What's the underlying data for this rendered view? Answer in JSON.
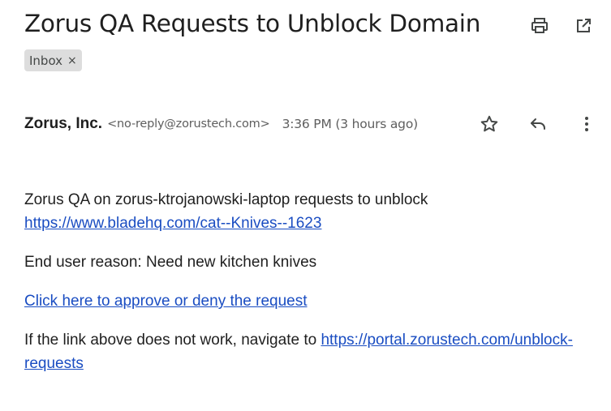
{
  "email": {
    "subject": "Zorus QA Requests to Unblock Domain",
    "label": "Inbox",
    "label_remove": "×",
    "sender_name": "Zorus, Inc.",
    "sender_email": "<no-reply@zorustech.com>",
    "time": "3:36 PM (3 hours ago)"
  },
  "toolbar": {
    "icons": [
      "print-icon",
      "open-in-new-window-icon",
      "star-icon",
      "reply-icon",
      "more-options-icon"
    ]
  },
  "body": {
    "line1_text": "Zorus QA on zorus-ktrojanowski-laptop requests to unblock",
    "line1_link": "https://www.bladehq.com/cat--Knives--1623",
    "reason": "End user reason: Need new kitchen knives",
    "approve_link": "Click here to approve or deny the request",
    "fallback_text": "If the link above does not work, navigate to ",
    "fallback_link": "https://portal.zorustech.com/unblock-requests"
  },
  "colors": {
    "link": "#1a4dc2",
    "text": "#1f1f1f",
    "chip_bg": "#dddddd"
  }
}
